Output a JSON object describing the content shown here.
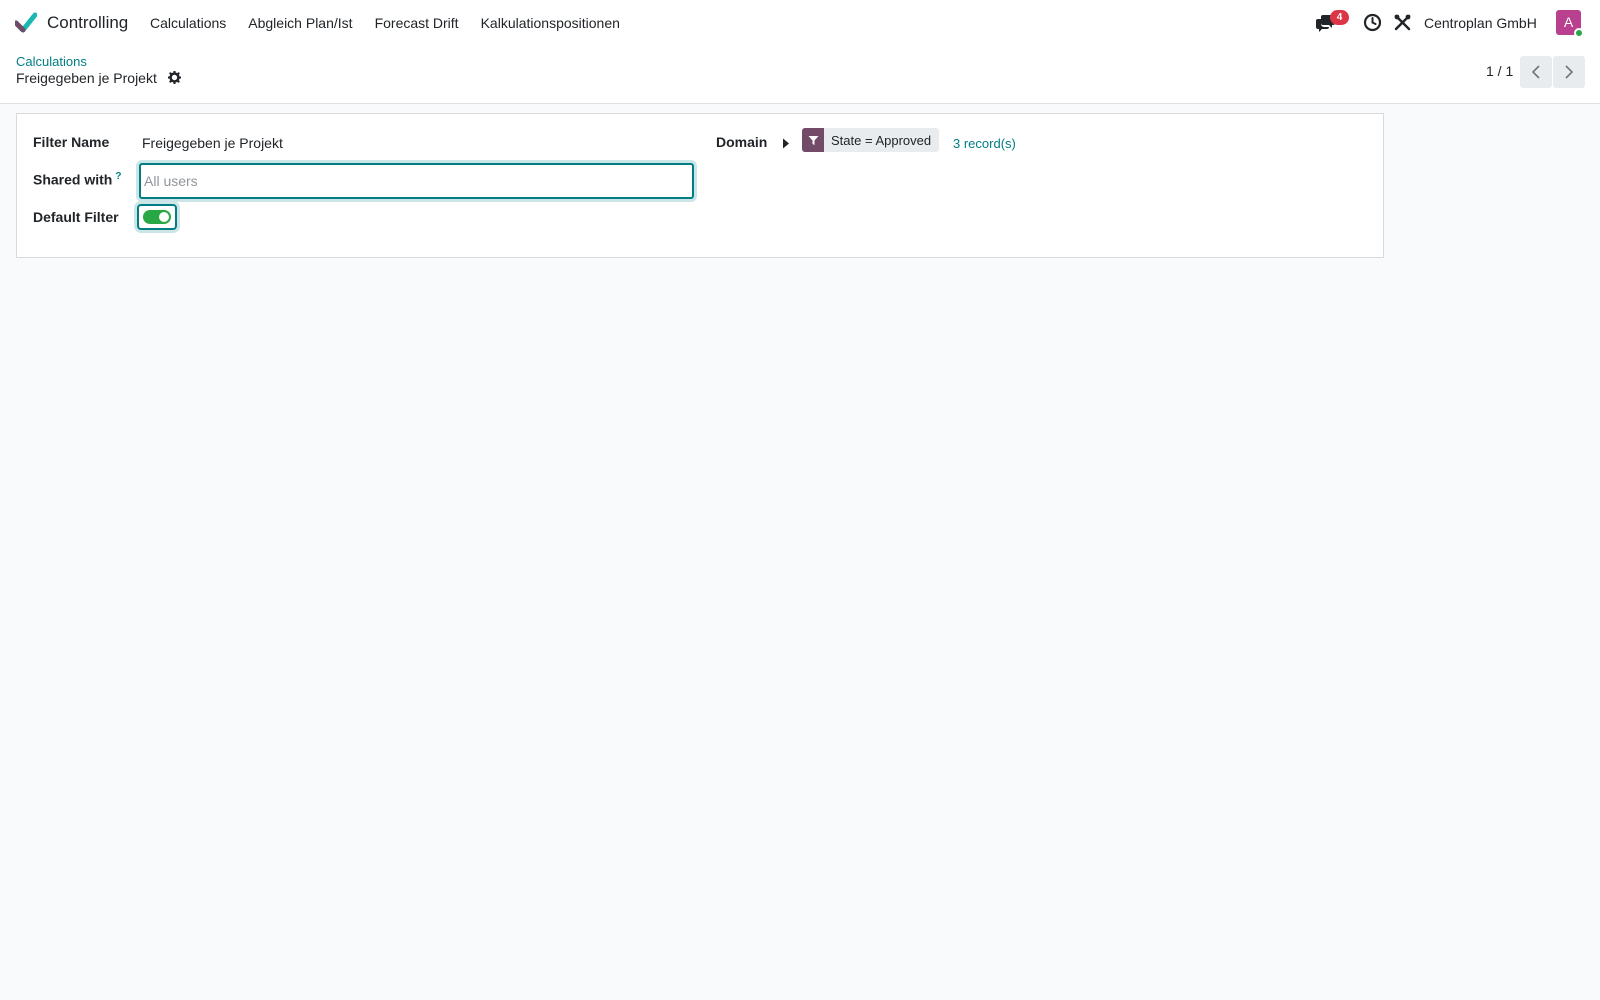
{
  "navbar": {
    "app_name": "Controlling",
    "menu": [
      "Calculations",
      "Abgleich Plan/Ist",
      "Forecast Drift",
      "Kalkulationspositionen"
    ],
    "chat_badge": "4",
    "company": "Centroplan GmbH",
    "avatar_initial": "A",
    "avatar_color": "#b93f8f"
  },
  "control_panel": {
    "breadcrumb": "Calculations",
    "title": "Freigegeben je Projekt",
    "pager": "1 / 1"
  },
  "form": {
    "filter_name_label": "Filter Name",
    "filter_name_value": "Freigegeben je Projekt",
    "shared_with_label": "Shared with",
    "shared_with_help": "?",
    "shared_with_placeholder": "All users",
    "default_filter_label": "Default Filter",
    "default_filter_enabled": true,
    "domain_label": "Domain",
    "domain_rule": "State = Approved",
    "record_count": "3 record(s)"
  },
  "colors": {
    "accent": "#017e84",
    "brand": "#714b67",
    "toggle_on": "#28a745",
    "badge": "#dc3545"
  },
  "icons": {
    "app": "checkmark-logo-icon",
    "chat": "chat-bubbles-icon",
    "clock": "clock-icon",
    "tools": "tools-icon",
    "gear": "gear-icon",
    "prev": "chevron-left-icon",
    "next": "chevron-right-icon",
    "caret": "caret-right-icon",
    "filter": "filter-icon"
  }
}
